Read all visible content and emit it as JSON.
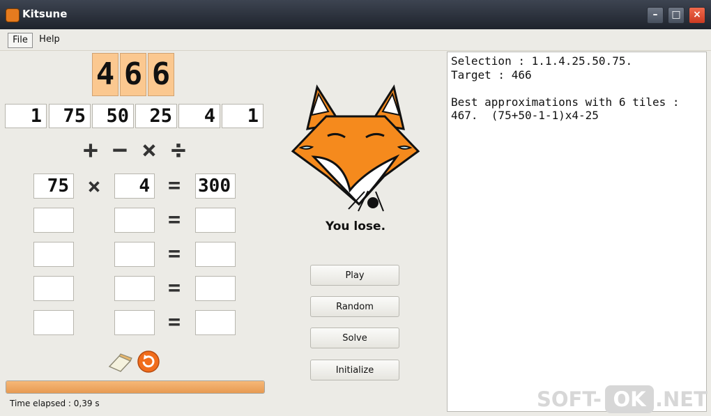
{
  "window": {
    "title": "Kitsune"
  },
  "menu": [
    "File",
    "Help"
  ],
  "target": [
    "4",
    "6",
    "6"
  ],
  "tiles": [
    "1",
    "75",
    "50",
    "25",
    "4",
    "1"
  ],
  "operators": [
    "+",
    "−",
    "×",
    "÷"
  ],
  "calculation": {
    "row1": {
      "left": "75",
      "operator": "×",
      "right": "4",
      "equals": "=",
      "result": "300"
    },
    "empty_equals": [
      "=",
      "=",
      "=",
      "="
    ]
  },
  "result_message": "You lose.",
  "buttons": [
    "Play",
    "Random",
    "Solve",
    "Initialize"
  ],
  "output": {
    "lines": [
      "Selection : 1.1.4.25.50.75.",
      "Target : 466",
      "",
      "Best approximations with 6 tiles :",
      "467.  (75+50-1-1)x4-25"
    ]
  },
  "status": "Time elapsed : 0,39 s",
  "progress_percent": 100,
  "icons": {
    "app": "fox-icon",
    "eraser": "eraser-icon",
    "reset": "refresh-icon"
  },
  "watermark": {
    "left": "SOFT-",
    "middle": "OK",
    "right": ".NET"
  }
}
